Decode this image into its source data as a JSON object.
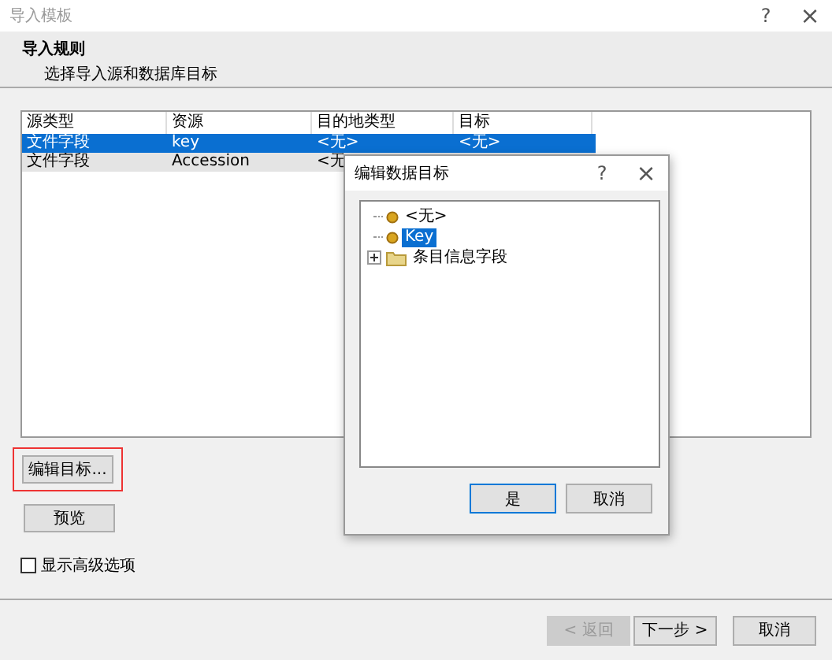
{
  "window": {
    "title": "导入模板",
    "help": "?",
    "close": "×"
  },
  "header": {
    "title": "导入规则",
    "subtitle": "选择导入源和数据库目标"
  },
  "table": {
    "columns": [
      "源类型",
      "资源",
      "目的地类型",
      "目标"
    ],
    "rows": [
      {
        "cells": [
          "文件字段",
          "key",
          "<无>",
          "<无>"
        ],
        "selected": true
      },
      {
        "cells": [
          "文件字段",
          "Accession",
          "<无",
          ""
        ],
        "selected": false
      }
    ]
  },
  "edit_button": {
    "label": "编辑目标...",
    "highlighted": true
  },
  "preview_button": {
    "label": "预览"
  },
  "advanced_checkbox": {
    "label": "显示高级选项",
    "checked": false
  },
  "footer_buttons": [
    {
      "label": "< 返回",
      "disabled": true
    },
    {
      "label": "下一步 >",
      "disabled": false
    },
    {
      "label": "取消",
      "disabled": false
    }
  ],
  "dialog": {
    "title": "编辑数据目标",
    "help": "?",
    "close": "×",
    "tree": [
      {
        "kind": "leaf",
        "label": "<无>",
        "selected": false
      },
      {
        "kind": "leaf",
        "label": "Key",
        "selected": true
      },
      {
        "kind": "folder",
        "label": "条目信息字段",
        "selected": false,
        "expanded": false
      }
    ],
    "buttons": [
      {
        "label": "是",
        "default": true
      },
      {
        "label": "取消",
        "default": false
      }
    ]
  }
}
